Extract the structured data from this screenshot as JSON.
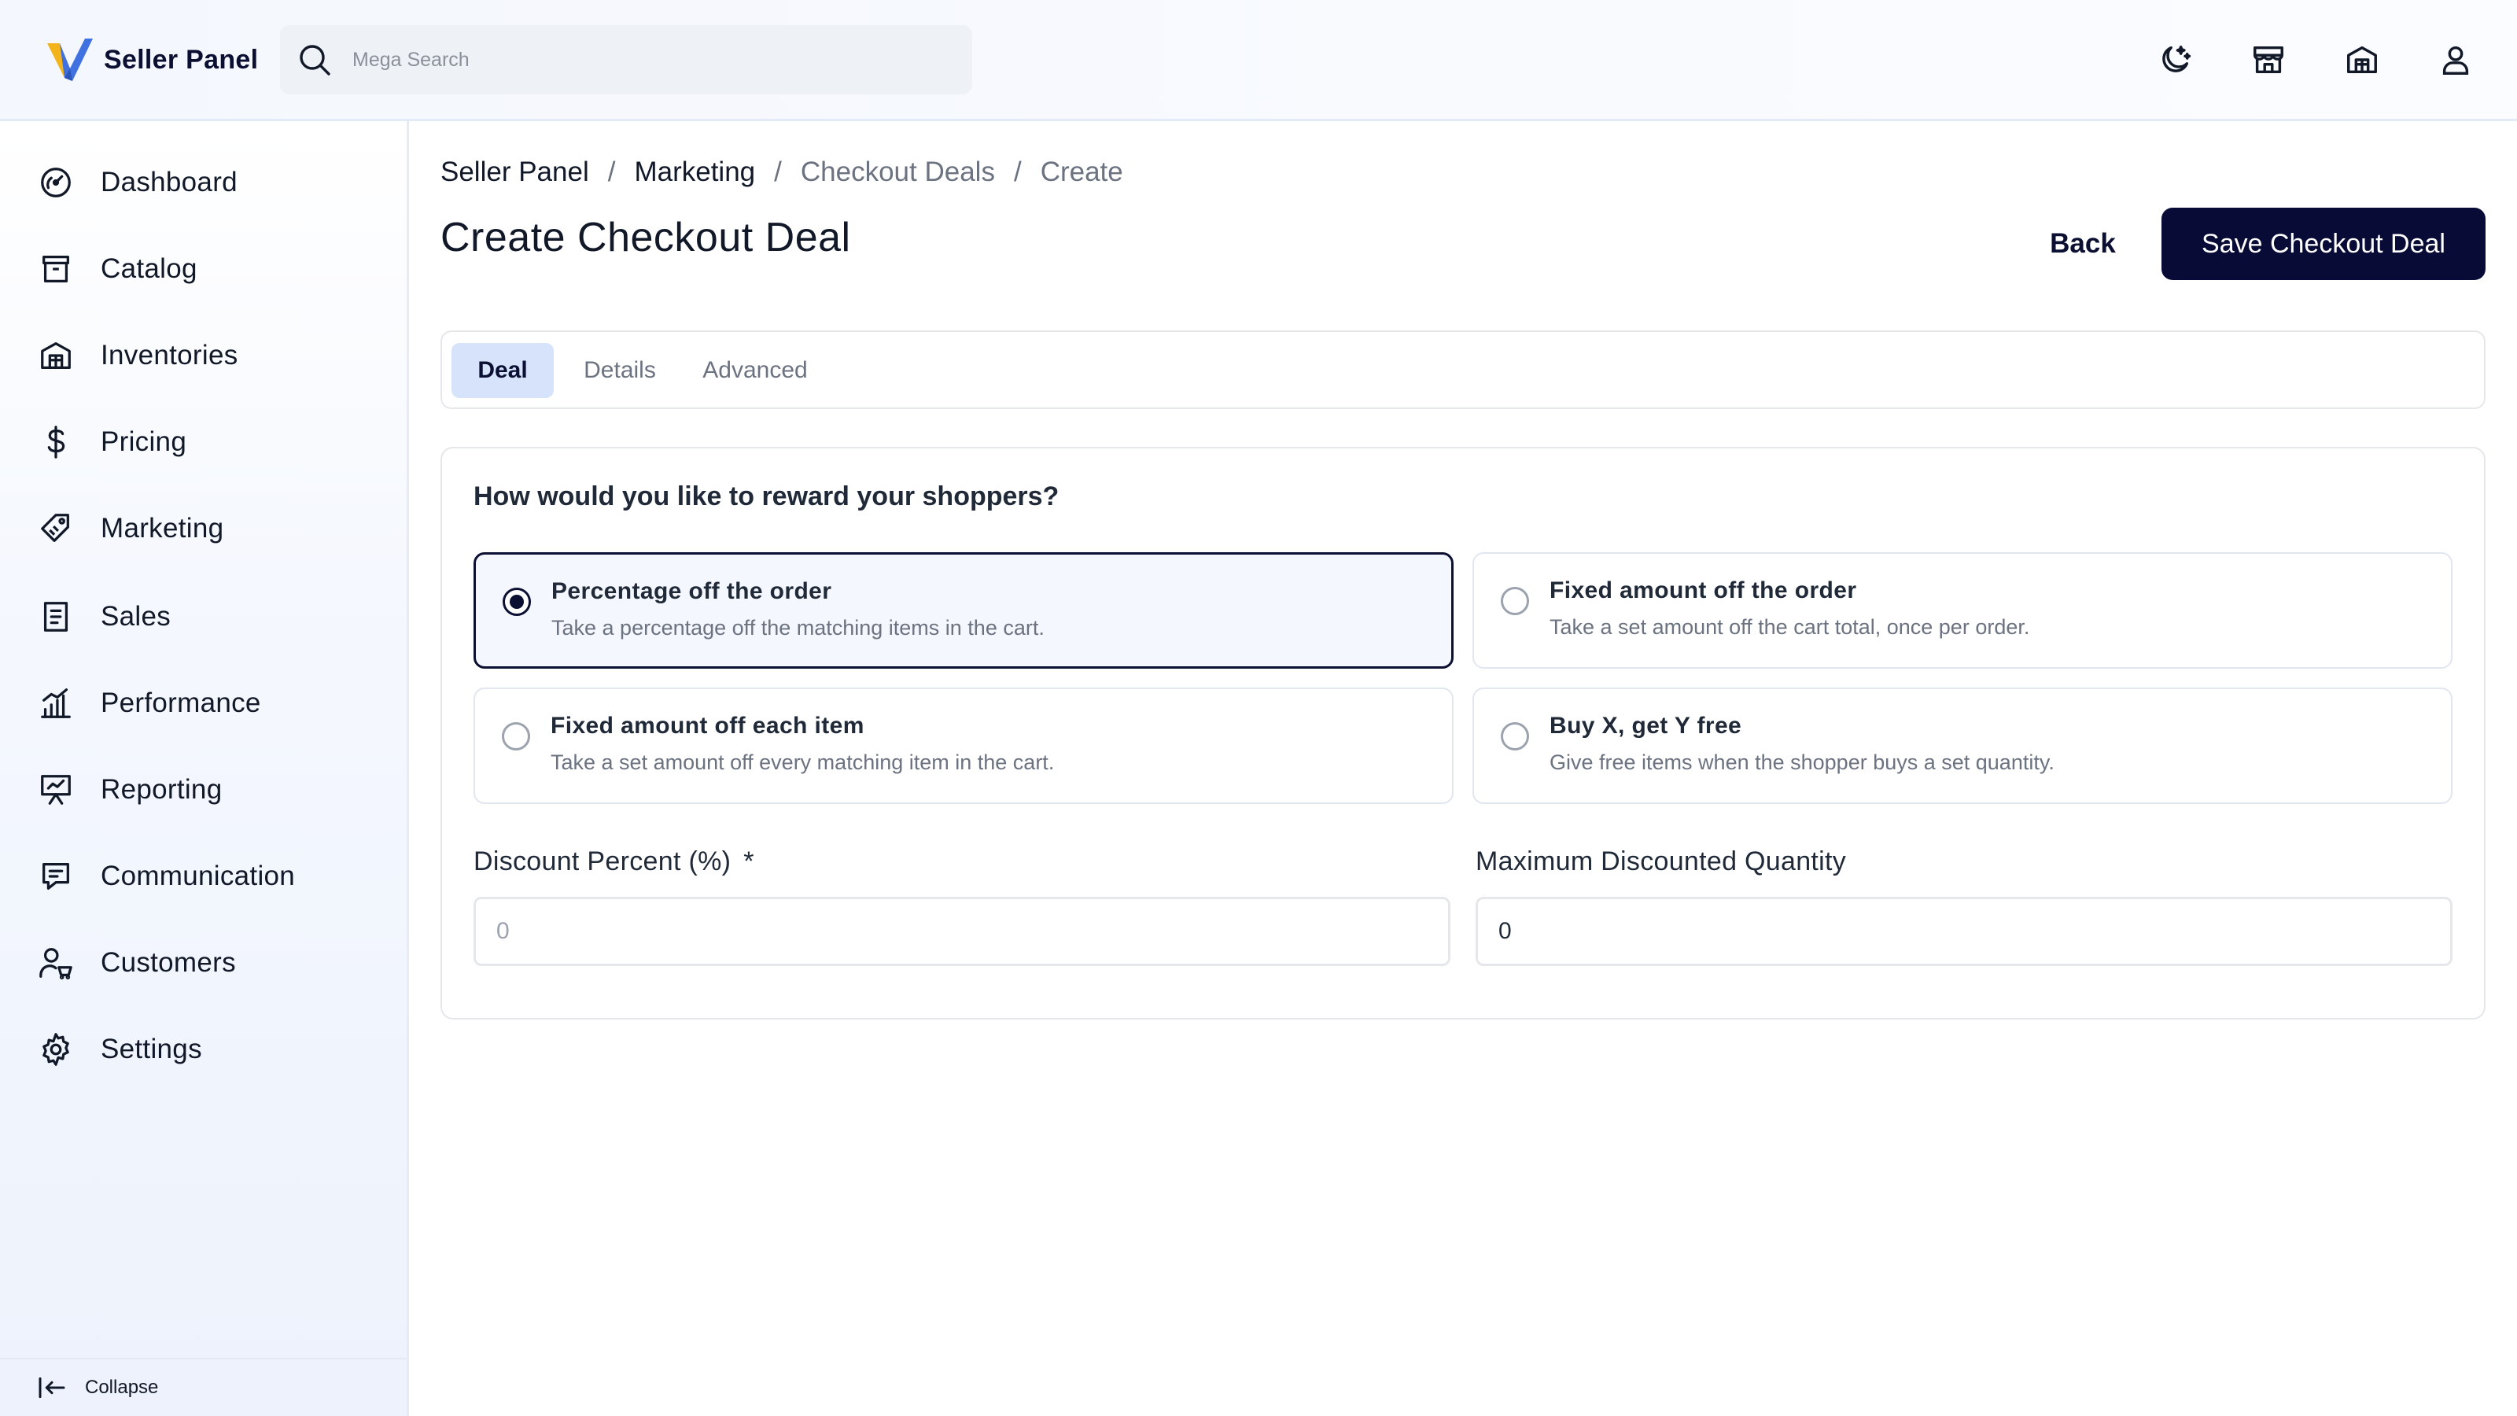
{
  "header": {
    "brand_name": "Seller Panel",
    "search_placeholder": "Mega Search",
    "actions": [
      {
        "icon": "moon-icon"
      },
      {
        "icon": "store-icon"
      },
      {
        "icon": "warehouse-icon"
      },
      {
        "icon": "user-icon"
      }
    ]
  },
  "sidebar": {
    "items": [
      {
        "label": "Dashboard",
        "icon": "dashboard-gauge-icon"
      },
      {
        "label": "Catalog",
        "icon": "catalog-box-icon"
      },
      {
        "label": "Inventories",
        "icon": "inventory-building-icon"
      },
      {
        "label": "Pricing",
        "icon": "dollar-icon"
      },
      {
        "label": "Marketing",
        "icon": "tags-icon"
      },
      {
        "label": "Sales",
        "icon": "receipt-icon"
      },
      {
        "label": "Performance",
        "icon": "bar-chart-icon"
      },
      {
        "label": "Reporting",
        "icon": "presentation-icon"
      },
      {
        "label": "Communication",
        "icon": "chat-icon"
      },
      {
        "label": "Customers",
        "icon": "customers-icon"
      },
      {
        "label": "Settings",
        "icon": "gear-icon"
      }
    ],
    "collapse_label": "Collapse"
  },
  "breadcrumb": [
    "Seller Panel",
    "Marketing",
    "Checkout Deals",
    "Create"
  ],
  "breadcrumb_separator": "/",
  "page": {
    "title": "Create Checkout Deal",
    "back_label": "Back",
    "save_label": "Save Checkout Deal"
  },
  "tabs": [
    {
      "label": "Deal",
      "active": true
    },
    {
      "label": "Details",
      "active": false
    },
    {
      "label": "Advanced",
      "active": false
    }
  ],
  "form": {
    "question": "How would you like to reward your shoppers?",
    "options": [
      {
        "title": "Percentage off the order",
        "description": "Take a percentage off the matching items in the cart.",
        "selected": true
      },
      {
        "title": "Fixed amount off the order",
        "description": "Take a set amount off the cart total, once per order.",
        "selected": false
      },
      {
        "title": "Fixed amount off each item",
        "description": "Take a set amount off every matching item in the cart.",
        "selected": false
      },
      {
        "title": "Buy X, get Y free",
        "description": "Give free items when the shopper buys a set quantity.",
        "selected": false
      }
    ],
    "discount_percent": {
      "label": "Discount Percent (%)",
      "required_mark": "*",
      "placeholder": "0",
      "value": ""
    },
    "max_quantity": {
      "label": "Maximum Discounted Quantity",
      "placeholder": "",
      "value": "0"
    }
  },
  "colors": {
    "primary": "#080b36",
    "active_tab_bg": "#d7e3fb",
    "logo_blue": "#3f71e0",
    "logo_gold": "#f3b41b"
  }
}
